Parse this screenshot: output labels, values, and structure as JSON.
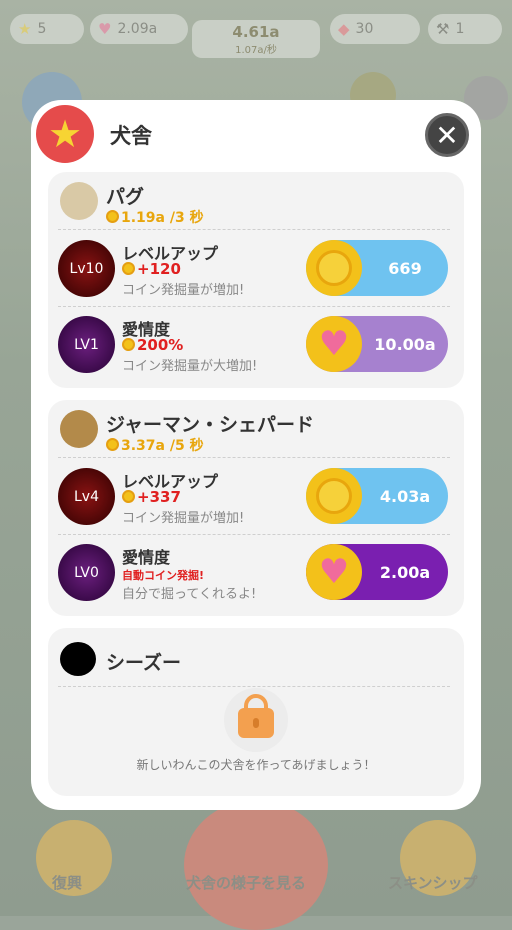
{
  "background": {
    "stars": "5",
    "hearts": "2.09a",
    "coins": "4.61a",
    "coin_rate": "1.07a/秒",
    "gems": "30",
    "tools": "1",
    "bottom_left": "復興",
    "bottom_center": "犬舎の様子を見る",
    "bottom_right": "スキンシップ"
  },
  "modal": {
    "title": "犬舎",
    "close_icon": "close-icon"
  },
  "dogs": [
    {
      "name": "パグ",
      "rate": "1.19a /3 秒",
      "level_row": {
        "level": "Lv10",
        "title": "レベルアップ",
        "value": "+120",
        "desc": "コイン発掘量が増加!",
        "button": "669"
      },
      "love_row": {
        "level": "LV1",
        "title": "愛情度",
        "value": "200%",
        "desc": "コイン発掘量が大増加!",
        "button": "10.00a"
      }
    },
    {
      "name": "ジャーマン・シェパード",
      "rate": "3.37a /5 秒",
      "level_row": {
        "level": "Lv4",
        "title": "レベルアップ",
        "value": "+337",
        "desc": "コイン発掘量が増加!",
        "button": "4.03a"
      },
      "love_row": {
        "level": "LV0",
        "title": "愛情度",
        "value": "自動コイン発掘!",
        "desc": "自分で掘ってくれるよ!",
        "button": "2.00a"
      }
    },
    {
      "name": "シーズー",
      "locked_text": "新しいわんこの犬舎を作ってあげましょう！"
    }
  ]
}
